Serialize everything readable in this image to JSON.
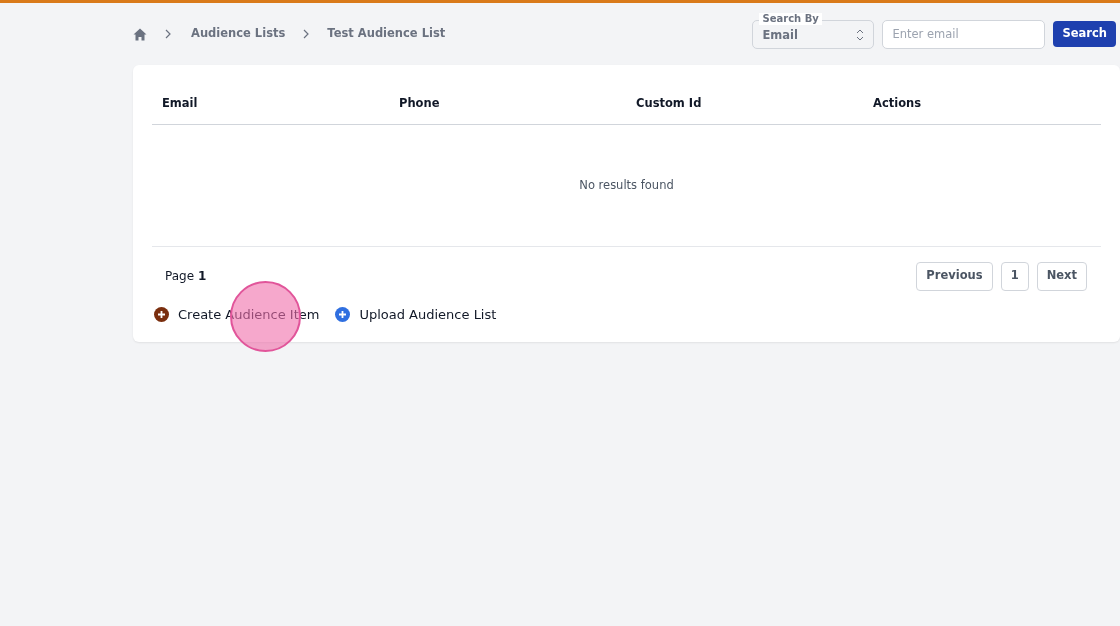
{
  "breadcrumb": {
    "items": [
      "Audience Lists",
      "Test Audience List"
    ]
  },
  "search": {
    "by_label": "Search By",
    "by_value": "Email",
    "placeholder": "Enter email",
    "button": "Search"
  },
  "table": {
    "columns": [
      "Email",
      "Phone",
      "Custom Id",
      "Actions"
    ],
    "empty_message": "No results found"
  },
  "pagination": {
    "page_text": "Page **1**",
    "previous": "Previous",
    "pages": [
      {
        "label": "1",
        "selected": false
      }
    ],
    "next": "Next"
  },
  "actions": [
    {
      "label": "Create Audience Item",
      "color": "#7a2e0e"
    },
    {
      "label": "Upload Audience List",
      "color": "#2f6fe0"
    }
  ]
}
